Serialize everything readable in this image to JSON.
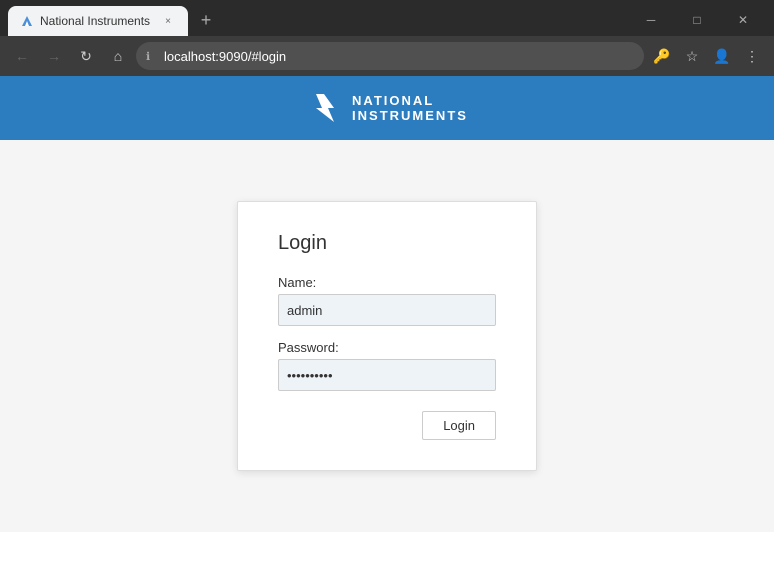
{
  "browser": {
    "tab": {
      "favicon": "🔧",
      "title": "National Instruments",
      "close_label": "×"
    },
    "new_tab_label": "+",
    "window_controls": {
      "minimize": "─",
      "maximize": "□",
      "close": "✕"
    },
    "nav": {
      "back": "←",
      "forward": "→",
      "reload": "↻",
      "home": "⌂"
    },
    "address": {
      "icon": "ℹ",
      "url": "localhost:9090/#login"
    },
    "toolbar": {
      "key_icon": "🔑",
      "star_icon": "☆",
      "profile_icon": "👤",
      "menu_icon": "⋮"
    }
  },
  "header": {
    "brand_line1": "NATIONAL",
    "brand_line2": "INSTRUMENTS"
  },
  "login": {
    "title": "Login",
    "name_label": "Name:",
    "name_value": "admin",
    "name_placeholder": "admin",
    "password_label": "Password:",
    "password_value": "••••••••••",
    "submit_label": "Login"
  }
}
